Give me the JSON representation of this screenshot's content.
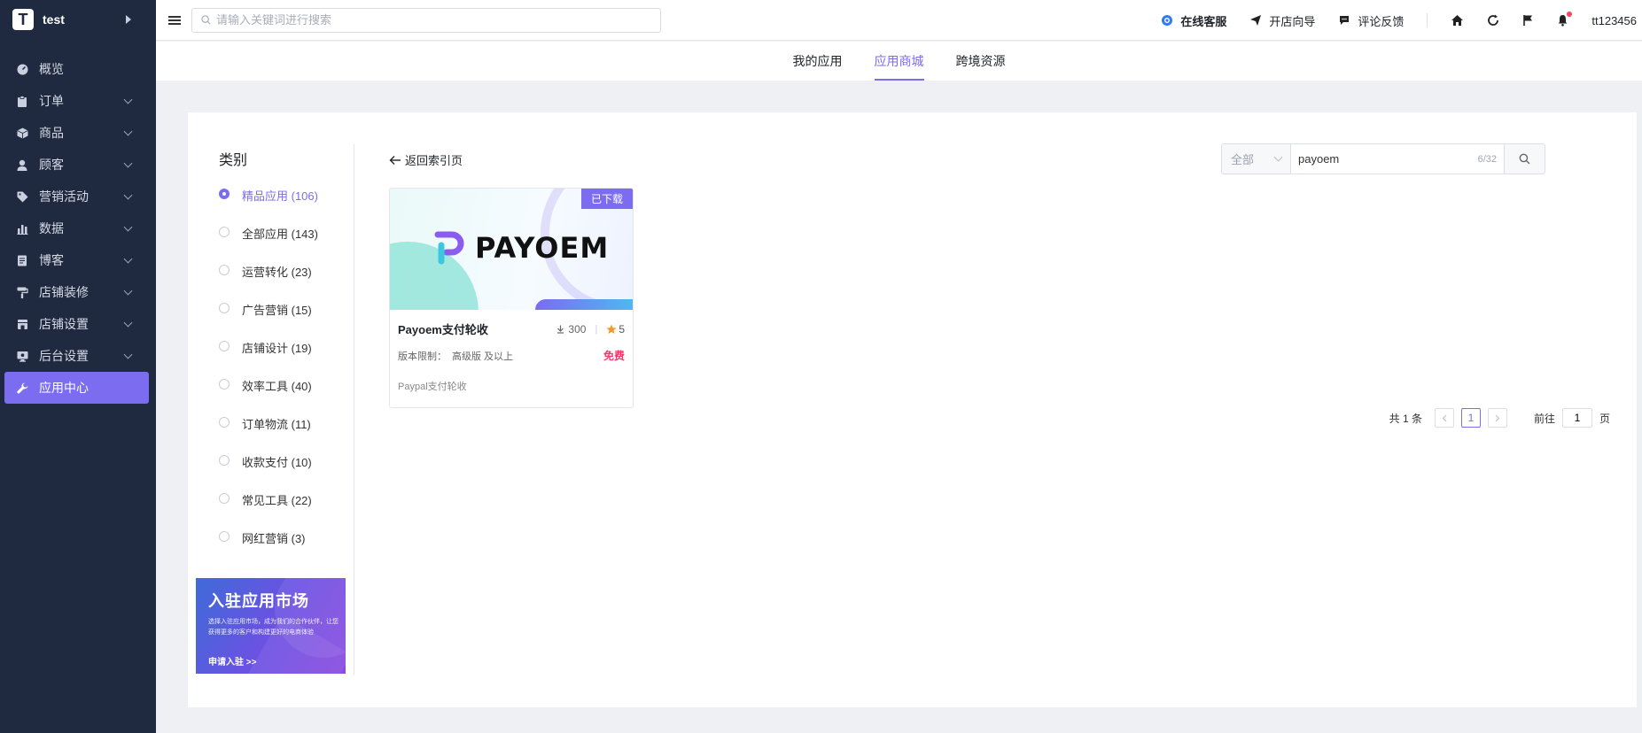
{
  "app": {
    "logo_letter": "T",
    "name": "test"
  },
  "sidebar": {
    "items": [
      {
        "label": "概览",
        "icon": "dashboard-icon",
        "expandable": false
      },
      {
        "label": "订单",
        "icon": "clipboard-icon",
        "expandable": true
      },
      {
        "label": "商品",
        "icon": "box-icon",
        "expandable": true
      },
      {
        "label": "顾客",
        "icon": "user-icon",
        "expandable": true
      },
      {
        "label": "营销活动",
        "icon": "tag-icon",
        "expandable": true
      },
      {
        "label": "数据",
        "icon": "bar-chart-icon",
        "expandable": true
      },
      {
        "label": "博客",
        "icon": "document-icon",
        "expandable": true
      },
      {
        "label": "店铺装修",
        "icon": "paint-roller-icon",
        "expandable": true
      },
      {
        "label": "店铺设置",
        "icon": "store-icon",
        "expandable": true
      },
      {
        "label": "后台设置",
        "icon": "monitor-icon",
        "expandable": true
      },
      {
        "label": "应用中心",
        "icon": "wrench-icon",
        "expandable": false,
        "active": true
      }
    ]
  },
  "header": {
    "search_placeholder": "请输入关键词进行搜索",
    "links": {
      "service": "在线客服",
      "guide": "开店向导",
      "feedback": "评论反馈"
    },
    "username": "tt123456"
  },
  "tabs": [
    {
      "label": "我的应用",
      "active": false
    },
    {
      "label": "应用商城",
      "active": true
    },
    {
      "label": "跨境资源",
      "active": false
    }
  ],
  "categories": {
    "title": "类别",
    "items": [
      {
        "label": "精品应用 (106)",
        "active": true
      },
      {
        "label": "全部应用 (143)",
        "active": false
      },
      {
        "label": "运营转化 (23)",
        "active": false
      },
      {
        "label": "广告营销 (15)",
        "active": false
      },
      {
        "label": "店铺设计 (19)",
        "active": false
      },
      {
        "label": "效率工具 (40)",
        "active": false
      },
      {
        "label": "订单物流 (11)",
        "active": false
      },
      {
        "label": "收款支付 (10)",
        "active": false
      },
      {
        "label": "常见工具 (22)",
        "active": false
      },
      {
        "label": "网红营销 (3)",
        "active": false
      }
    ]
  },
  "banner": {
    "title": "入驻应用市场",
    "desc": "选择入驻应用市场，成为我们的合作伙伴，让您获得更多的客户和构建更好的电商体验",
    "cta": "申请入驻 >>"
  },
  "main": {
    "back_label": "返回索引页",
    "filter": {
      "select_value": "全部",
      "query": "payoem",
      "counter": "6/32"
    },
    "apps": [
      {
        "logo_text": "PAYOEM",
        "badge": "已下载",
        "name": "Payoem支付轮收",
        "downloads": "300",
        "rating": "5",
        "version_label": "版本限制：",
        "version_value": "高级版 及以上",
        "price": "免费",
        "desc": "Paypal支付轮收"
      }
    ]
  },
  "pagination": {
    "total": "共 1 条",
    "current": "1",
    "goto_label": "前往",
    "goto_value": "1",
    "page_suffix": "页"
  },
  "colors": {
    "accent": "#7b6cf0",
    "sidebar_bg": "#1f2940",
    "price": "#f03a6a"
  }
}
